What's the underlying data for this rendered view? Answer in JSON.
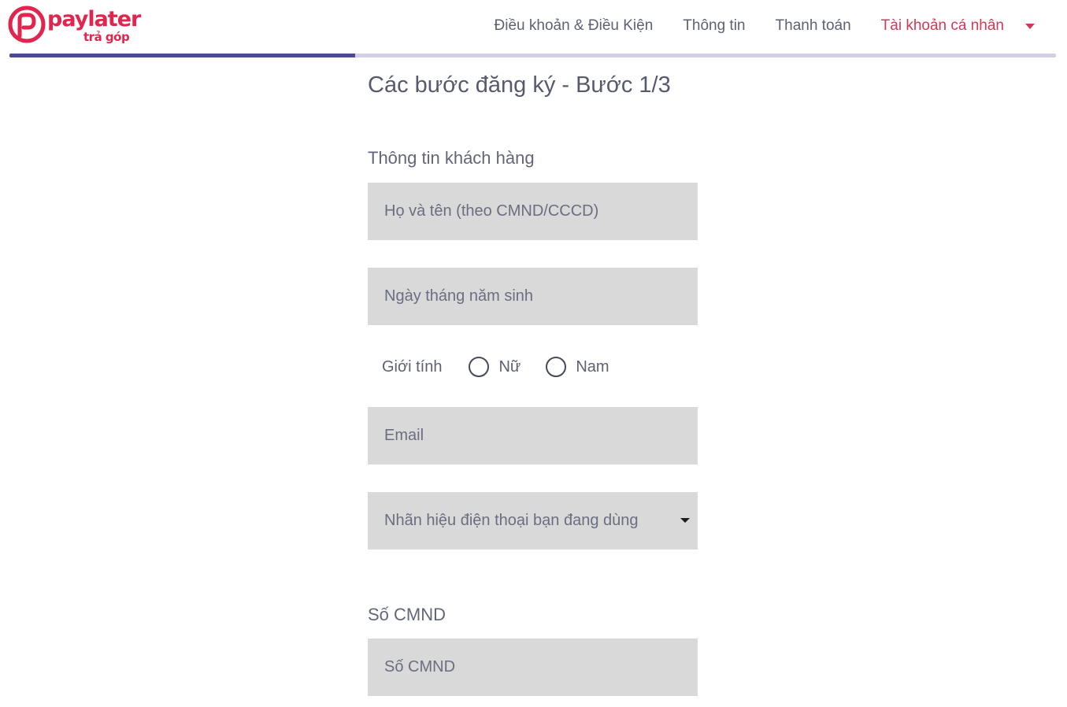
{
  "brand": {
    "name": "paylater",
    "tagline": "trả góp",
    "color": "#e0264e"
  },
  "nav": {
    "items": [
      {
        "label": "Điều khoản & Điều Kiện",
        "active": false
      },
      {
        "label": "Thông tin",
        "active": false
      },
      {
        "label": "Thanh toán",
        "active": false
      },
      {
        "label": "Tài khoản cá nhân",
        "active": true
      }
    ],
    "caret_icon": "caret-down-icon",
    "active_color": "#cf3a57"
  },
  "progress": {
    "fraction": 0.33,
    "fill_color": "#4a4a8e",
    "track_color": "#cfd0e6"
  },
  "form": {
    "step_title": "Các bước đăng ký - Bước 1/3",
    "customer_section_label": "Thông tin khách hàng",
    "full_name": {
      "placeholder": "Họ và tên (theo CMND/CCCD)",
      "value": ""
    },
    "dob": {
      "placeholder": "Ngày tháng năm sinh",
      "value": ""
    },
    "gender": {
      "label": "Giới tính",
      "options": [
        "Nữ",
        "Nam"
      ],
      "selected": null
    },
    "email": {
      "placeholder": "Email",
      "value": ""
    },
    "phone_brand": {
      "selected_text": "Nhãn hiệu điện thoại bạn đang dùng",
      "icon": "caret-down-icon"
    },
    "cmnd_section_label": "Số CMND",
    "cmnd": {
      "placeholder": "Số CMND",
      "value": ""
    }
  },
  "colors": {
    "field_bg": "#d9d9d9",
    "text": "#5e6175"
  }
}
